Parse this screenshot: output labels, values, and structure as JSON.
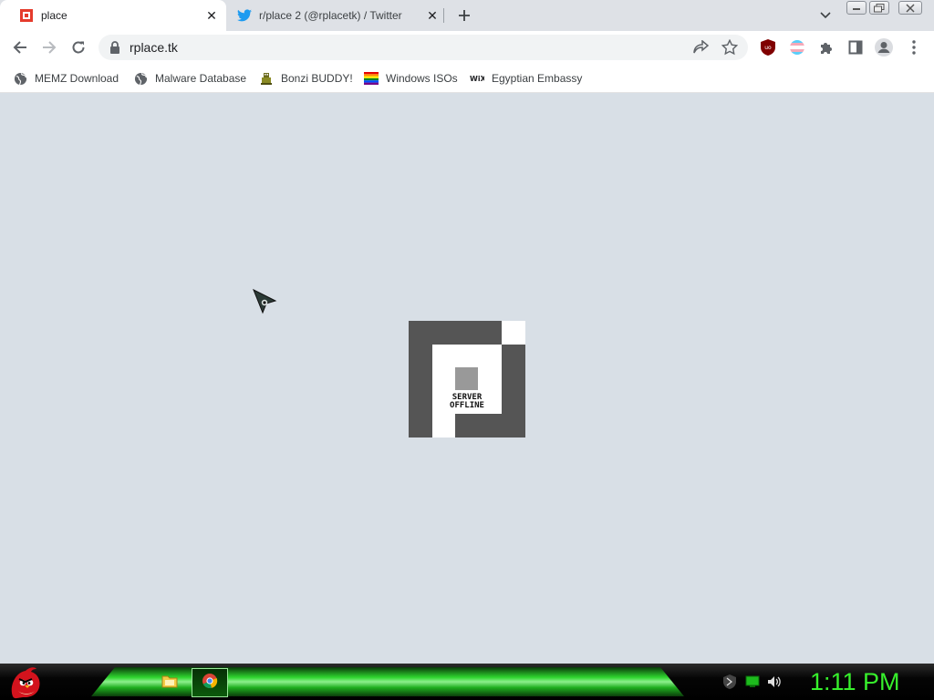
{
  "browser": {
    "tabs": [
      {
        "title": "place",
        "icon": "rplace-favicon",
        "active": true
      },
      {
        "title": "r/place 2 (@rplacetk) / Twitter",
        "icon": "twitter-icon",
        "active": false
      }
    ],
    "address_bar": {
      "url": "rplace.tk"
    },
    "bookmarks": [
      {
        "label": "MEMZ Download",
        "icon": "globe-icon"
      },
      {
        "label": "Malware Database",
        "icon": "globe-icon"
      },
      {
        "label": "Bonzi BUDDY!",
        "icon": "bonzi-icon"
      },
      {
        "label": "Windows ISOs",
        "icon": "windows-flag-icon"
      },
      {
        "label": "Egyptian Embassy",
        "icon": "wix-icon"
      }
    ],
    "colors": {
      "tabstrip": "#dee1e6",
      "omnibox": "#f1f3f4"
    }
  },
  "page": {
    "status_lines": [
      "SERVER",
      "OFFLINE"
    ],
    "background": "#d8dfe6"
  },
  "taskbar": {
    "clock": "1:11 PM",
    "apps": [
      "file-explorer-icon",
      "chrome-icon"
    ],
    "tray": [
      "shield-icon",
      "network-icon",
      "volume-icon"
    ],
    "clock_color": "#37ef2c"
  }
}
